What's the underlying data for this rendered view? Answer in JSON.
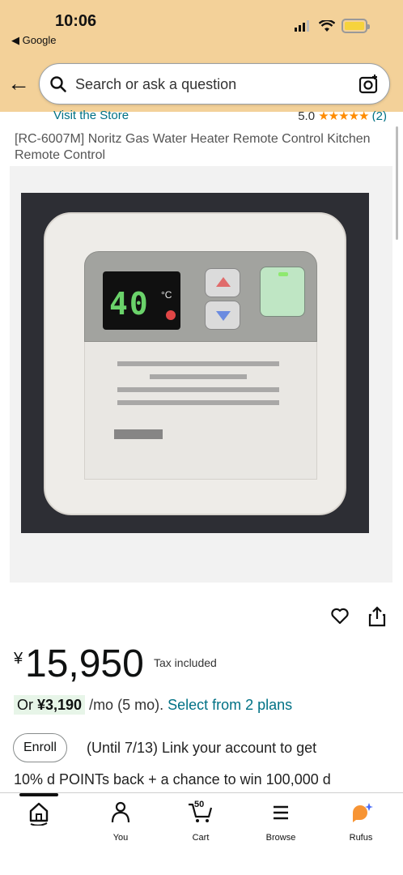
{
  "status_bar": {
    "time": "10:06",
    "back_app": "◀ Google"
  },
  "search": {
    "placeholder": "Search or ask a question"
  },
  "partial_row": {
    "store_link": "Visit the Store",
    "rating_value": "5.0",
    "stars": "★★★★★",
    "review_count": "(2)"
  },
  "product": {
    "title": "[RC-6007M] Noritz Gas Water Heater Remote Control Kitchen Remote Control"
  },
  "image": {
    "display_temp": "40",
    "display_unit": "°C"
  },
  "price": {
    "currency": "¥",
    "amount": "15,950",
    "tax_note": "Tax included",
    "installment_prefix": "Or ",
    "installment_amount": "¥3,190",
    "installment_suffix": " /mo (5 mo). ",
    "plans_link": "Select from 2 plans"
  },
  "promo": {
    "enroll_label": "Enroll",
    "line1": "(Until 7/13) Link your account to get",
    "line2": "10% d POINTs back + a chance to win 100,000 d"
  },
  "bottom_nav": {
    "home": "",
    "you": "You",
    "cart": "Cart",
    "cart_count": "50",
    "browse": "Browse",
    "rufus": "Rufus"
  },
  "colors": {
    "header_bg": "#f3d199",
    "link": "#007185",
    "star": "#ff8c00",
    "rufus_orange": "#f79434",
    "rufus_blue": "#4a6cf7"
  }
}
